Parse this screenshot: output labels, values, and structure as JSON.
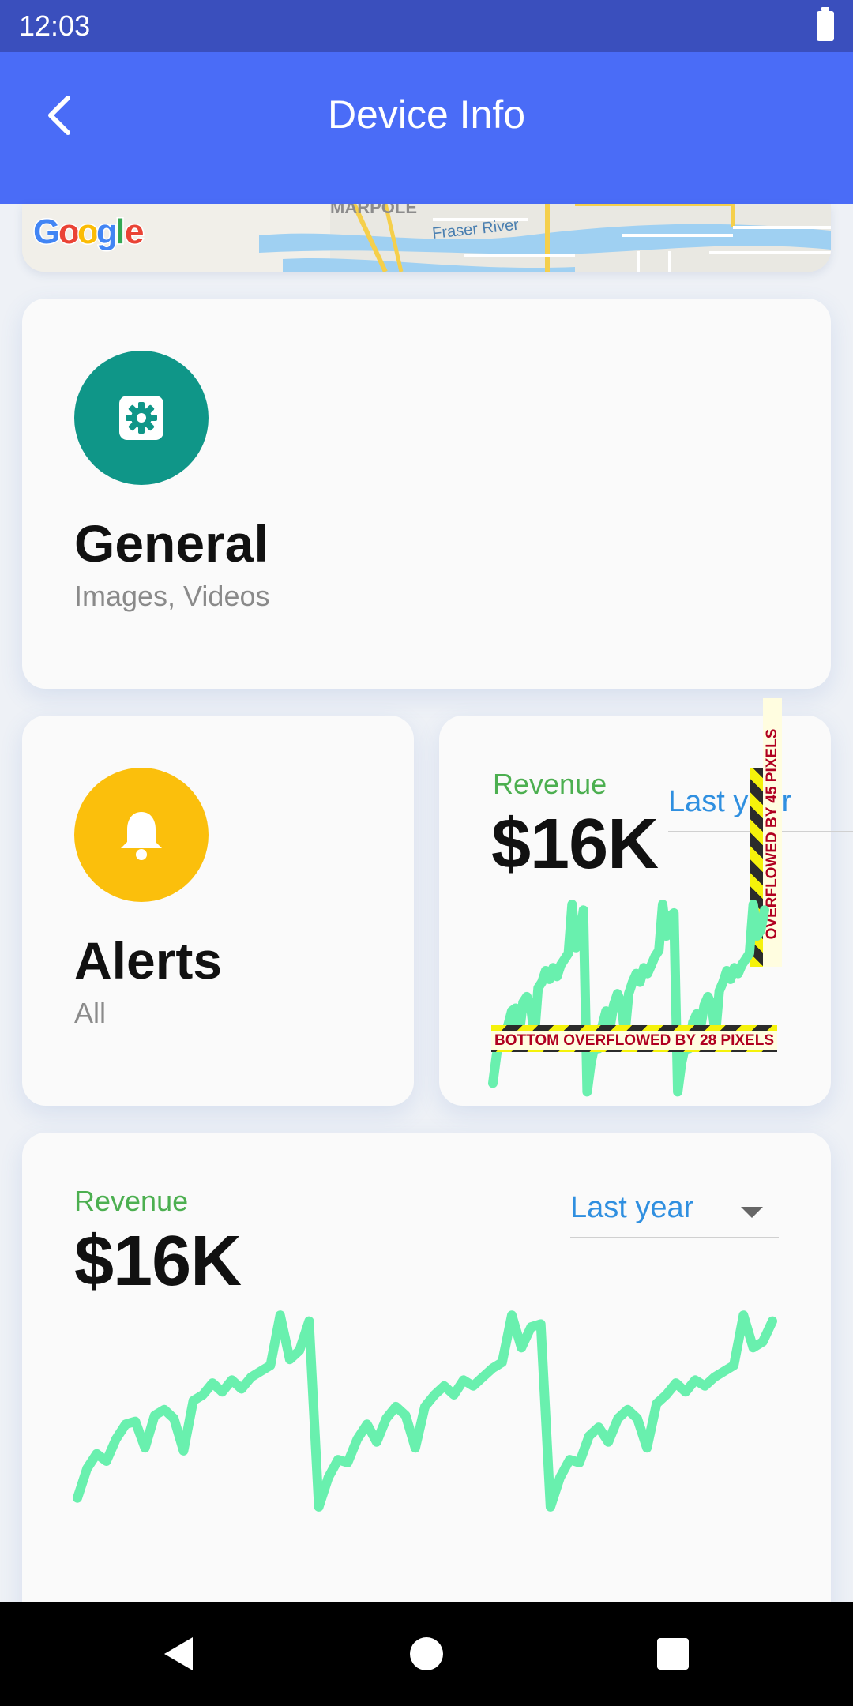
{
  "status_bar": {
    "time": "12:03",
    "battery_icon": "battery-icon"
  },
  "app_bar": {
    "title": "Device Info",
    "back_icon": "chevron-left-icon"
  },
  "map": {
    "logo": "Google",
    "labels": [
      "MARPOLE",
      "Fraser River"
    ]
  },
  "general_card": {
    "title": "General",
    "subtitle": "Images, Videos",
    "icon": "gear-icon",
    "color": "#0f9688"
  },
  "alerts_card": {
    "title": "Alerts",
    "subtitle": "All",
    "icon": "bell-icon",
    "color": "#fbbf0c"
  },
  "revenue_small": {
    "label": "Revenue",
    "value": "$16K",
    "dropdown_value": "Last year",
    "overflow_bottom": "BOTTOM OVERFLOWED BY 28 PIXELS",
    "overflow_right": "OVERFLOWED BY 45 PIXELS"
  },
  "revenue_big": {
    "label": "Revenue",
    "value": "$16K",
    "dropdown_value": "Last year"
  },
  "chart_data": {
    "type": "line",
    "series": [
      {
        "values": [
          2,
          4,
          5,
          4.5,
          6,
          7,
          7.2,
          5.4,
          7.6,
          8,
          7.4,
          5.2,
          8.6,
          9,
          9.8,
          9.2,
          10,
          9.4,
          10.2,
          10.6,
          11,
          14.4,
          11.4,
          12,
          14,
          1.4,
          3.4,
          4.6,
          4.4,
          6,
          7,
          5.8,
          7.4,
          8.2,
          7.6,
          5.4,
          8.2,
          9,
          9.6,
          9,
          10,
          9.6,
          10.2,
          10.8,
          11.2,
          14.4,
          12.2,
          13.6,
          13.8,
          1.4,
          3.4,
          4.6,
          4.4,
          6.2,
          6.8,
          5.8,
          7.4,
          8,
          7.4,
          5.4,
          8.4,
          9,
          9.8,
          9.2,
          10,
          9.6,
          10.2,
          10.6,
          11,
          14.4,
          12.2,
          12.6,
          14
        ]
      }
    ],
    "color": "#69f0ae"
  },
  "nav_bar": {
    "back": "back-triangle-icon",
    "home": "home-circle-icon",
    "recents": "recents-square-icon"
  }
}
